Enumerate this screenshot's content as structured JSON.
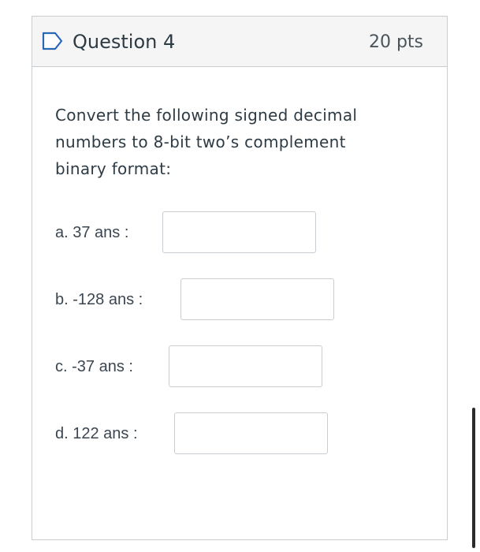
{
  "question": {
    "title": "Question 4",
    "points": "20 pts",
    "flag_icon": "bookmark-flag-icon",
    "prompt": "Convert the following signed decimal numbers to 8-bit two’s complement binary format:"
  },
  "answers": [
    {
      "label": "a. 37 ans :",
      "value": "",
      "placeholder": ""
    },
    {
      "label": "b. -128 ans :",
      "value": "",
      "placeholder": ""
    },
    {
      "label": "c. -37 ans :",
      "value": "",
      "placeholder": ""
    },
    {
      "label": "d. 122 ans :",
      "value": "",
      "placeholder": ""
    }
  ],
  "colors": {
    "header_background": "#f5f5f5",
    "border": "#c7cdd1",
    "text": "#2d3b45"
  }
}
